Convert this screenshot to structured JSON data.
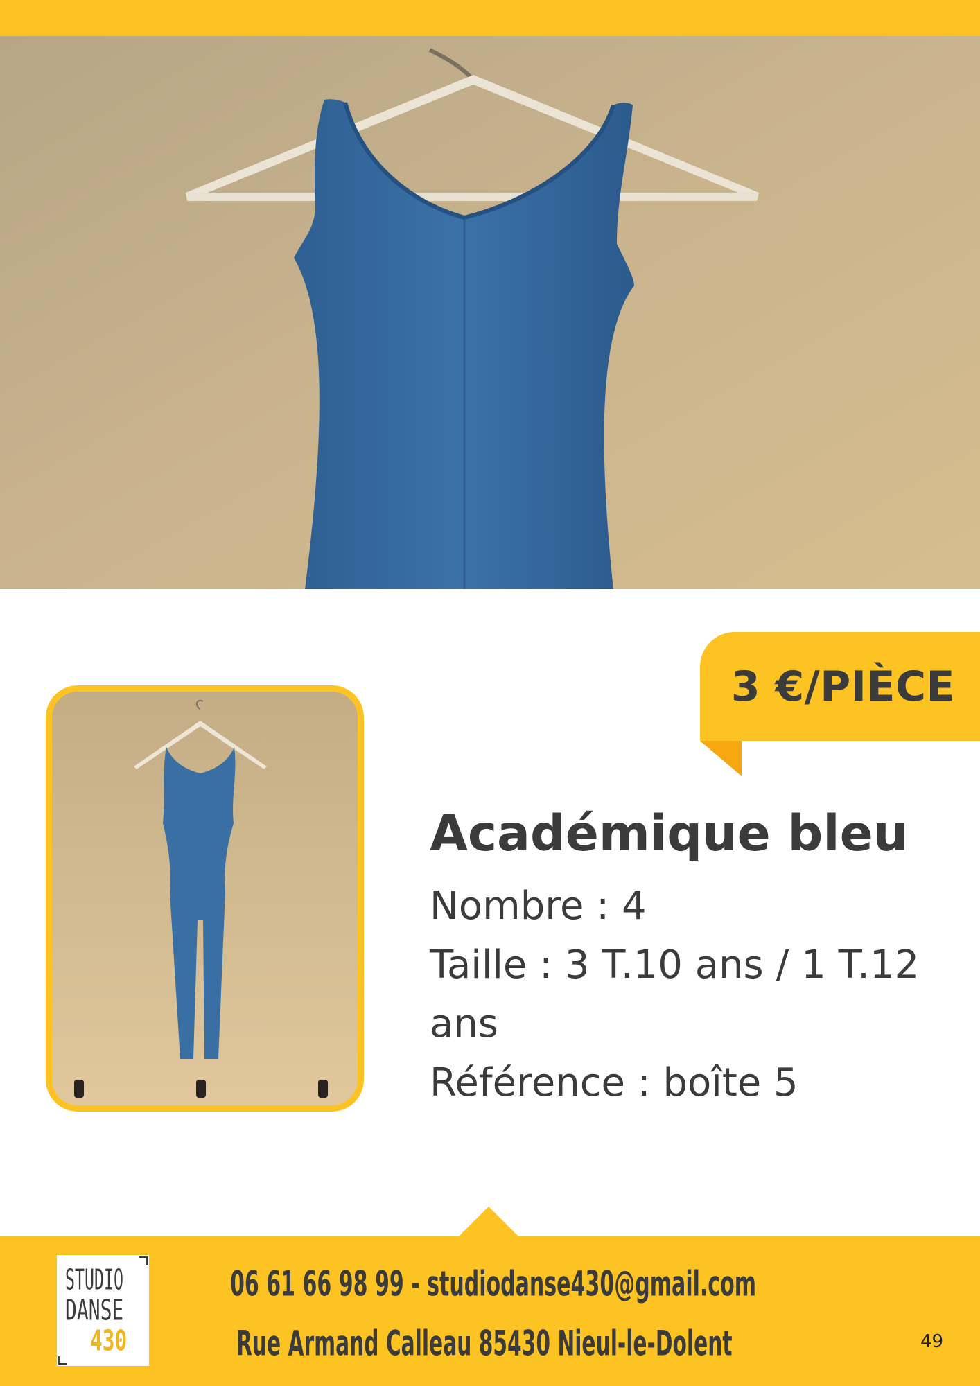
{
  "header": {
    "accent_color": "#fcc323"
  },
  "hero_image": {
    "subject": "blue sleeveless leotard on white hanger against beige wall"
  },
  "thumbnail_image": {
    "subject": "full-length blue unitard hanging on wall hooks",
    "border_color": "#fcc323"
  },
  "price": {
    "label": "3 €/PIÈCE",
    "tab_color": "#fcc323",
    "fold_color": "#f7a70f"
  },
  "product": {
    "title": "Académique bleu",
    "nombre": "Nombre : 4",
    "taille_line1": "Taille : 3 T.10 ans / 1 T.12",
    "taille_line2": "ans",
    "reference": "Référence : boîte 5"
  },
  "footer": {
    "logo": {
      "line1": "STUDIO",
      "line2": "DANSE",
      "line3": "430"
    },
    "contact_line": "06 61 66 98 99 - studiodanse430@gmail.com",
    "address_line": "Rue Armand Calleau 85430 Nieul-le-Dolent",
    "page_number": "49"
  }
}
